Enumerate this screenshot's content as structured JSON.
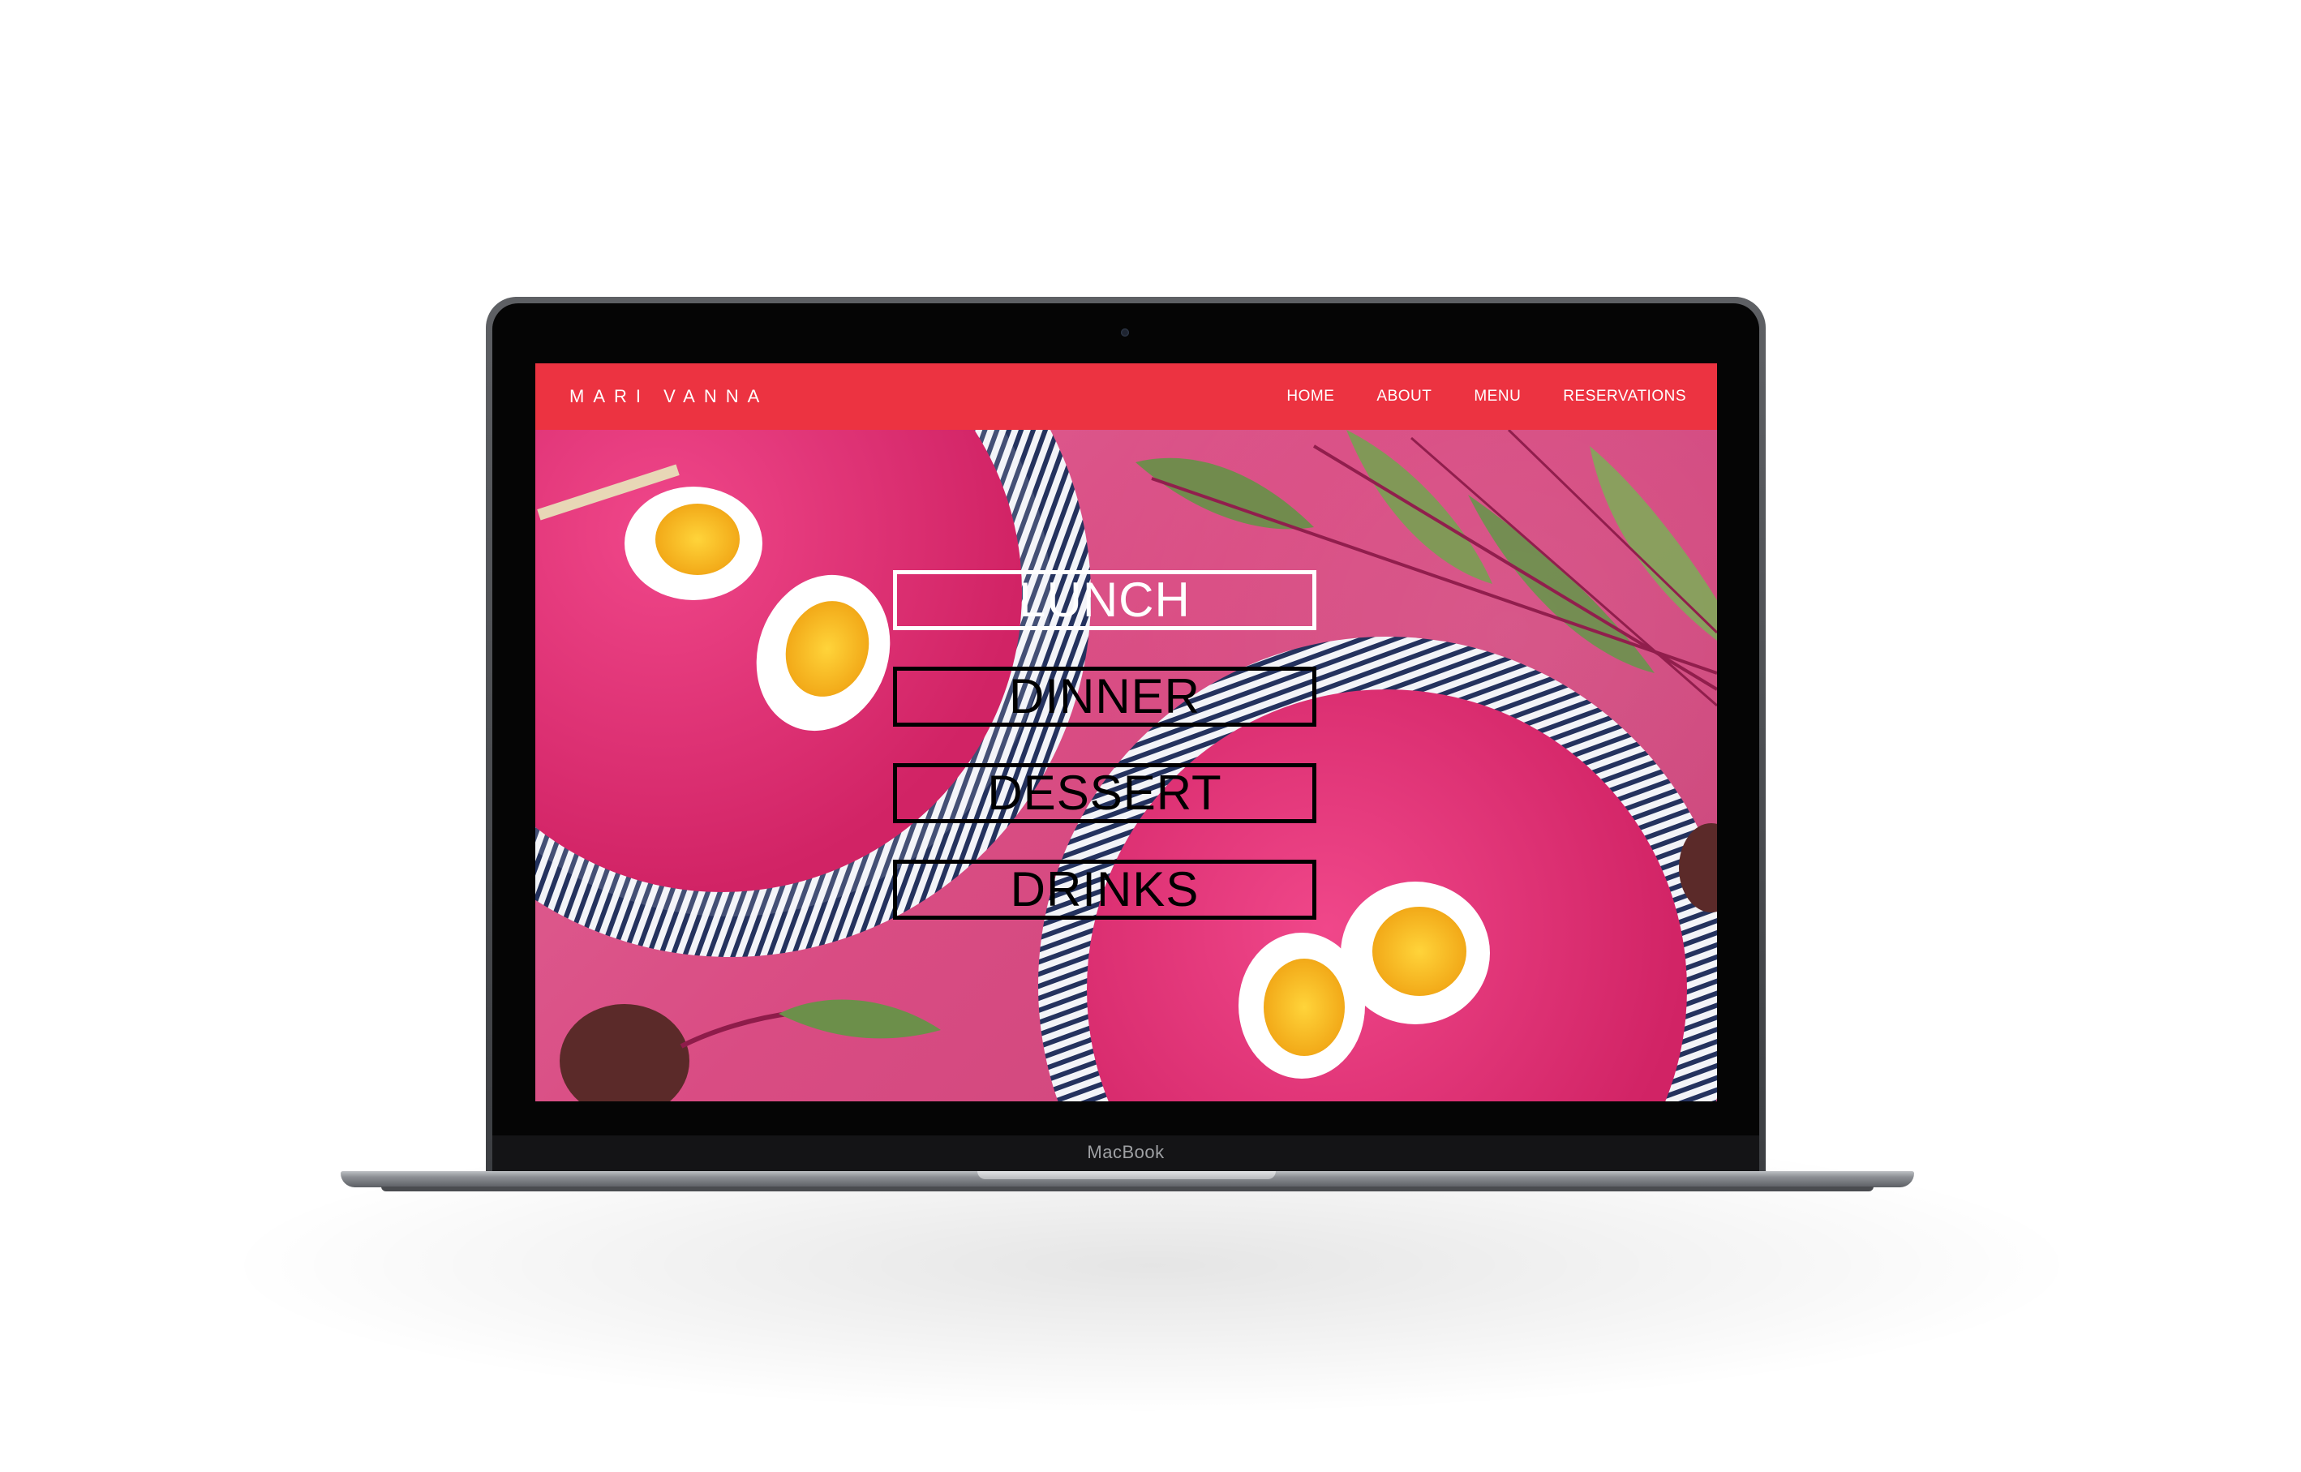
{
  "device": {
    "label": "MacBook"
  },
  "site": {
    "brand": "MARI VANNA",
    "nav": [
      {
        "label": "HOME"
      },
      {
        "label": "ABOUT"
      },
      {
        "label": "MENU"
      },
      {
        "label": "RESERVATIONS"
      }
    ],
    "categories": [
      {
        "label": "LUNCH",
        "active": true
      },
      {
        "label": "DINNER",
        "active": false
      },
      {
        "label": "DESSERT",
        "active": false
      },
      {
        "label": "DRINKS",
        "active": false
      }
    ]
  },
  "colors": {
    "navbar": "#ec3341",
    "soup": "#e0306f",
    "tablecloth": "#d94c83"
  },
  "icons": {
    "camera": "webcam-icon"
  }
}
